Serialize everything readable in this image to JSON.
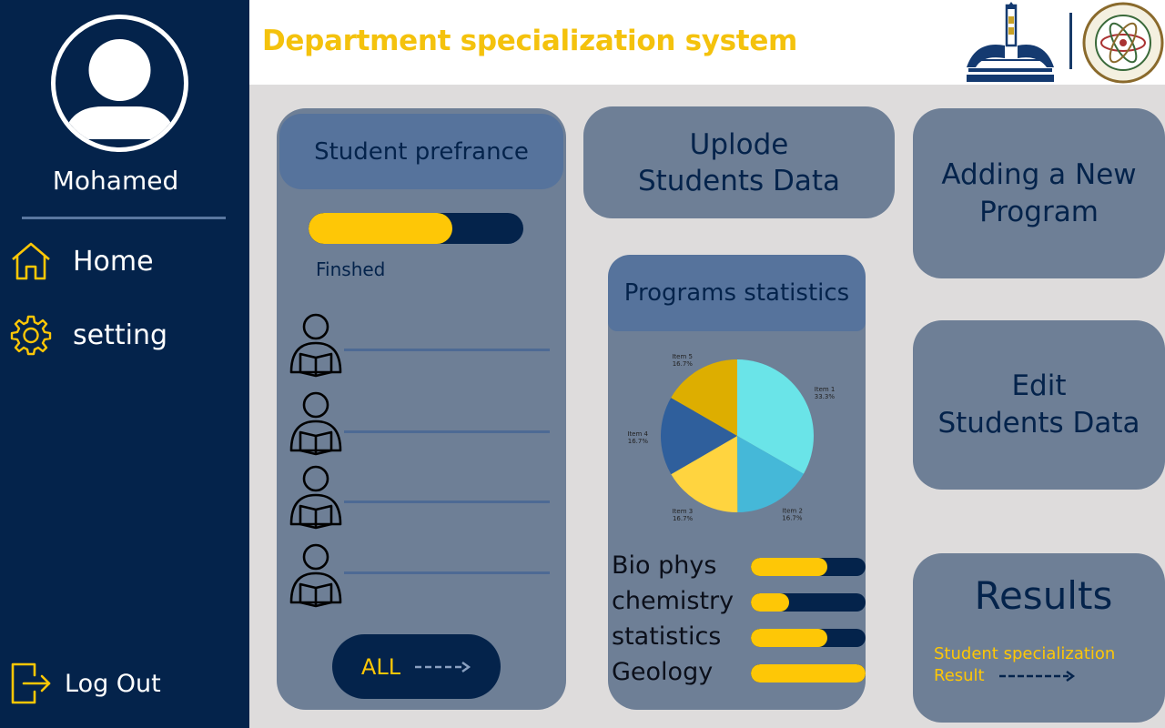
{
  "header": {
    "title": "Department specialization system",
    "logos": [
      "ain-shams-university-logo",
      "faculty-of-science-logo"
    ]
  },
  "sidebar": {
    "user_name": "Mohamed",
    "items": [
      {
        "label": "Home",
        "icon": "home-icon"
      },
      {
        "label": "setting",
        "icon": "gear-icon"
      }
    ],
    "logout_label": "Log Out"
  },
  "student_preference": {
    "title": "Student prefrance",
    "progress": 0.67,
    "status_label": "Finshed",
    "all_button_label": "ALL"
  },
  "upload_card": {
    "line1": "Uplode",
    "line2": "Students Data"
  },
  "programs_statistics": {
    "title": "Programs statistics",
    "programs": [
      {
        "name": "Bio phys",
        "level": 0.67
      },
      {
        "name": "chemistry",
        "level": 0.33
      },
      {
        "name": "statistics",
        "level": 0.67
      },
      {
        "name": "Geology",
        "level": 1.0
      }
    ]
  },
  "chart_data": {
    "type": "pie",
    "slices": [
      {
        "label": "Item 1",
        "value": 33.3,
        "display": "33.3%",
        "color": "#6ae4e8"
      },
      {
        "label": "Item 2",
        "value": 16.7,
        "display": "16.7%",
        "color": "#45b8d8"
      },
      {
        "label": "Item 3",
        "value": 16.7,
        "display": "16.7%",
        "color": "#ffd43f"
      },
      {
        "label": "Item 4",
        "value": 16.7,
        "display": "16.7%",
        "color": "#2f5f9c"
      },
      {
        "label": "Item 5",
        "value": 16.7,
        "display": "16.7%",
        "color": "#ddae00"
      }
    ]
  },
  "add_program_card": {
    "line1": "Adding a New",
    "line2": "Program"
  },
  "edit_card": {
    "line1": "Edit",
    "line2": "Students Data"
  },
  "results_card": {
    "title": "Results",
    "subtitle": "Student specialization",
    "link_label": "Result"
  },
  "colors": {
    "navy": "#04234b",
    "accent": "#fec706",
    "card": "#6e7f96",
    "card_header": "#56739c"
  }
}
